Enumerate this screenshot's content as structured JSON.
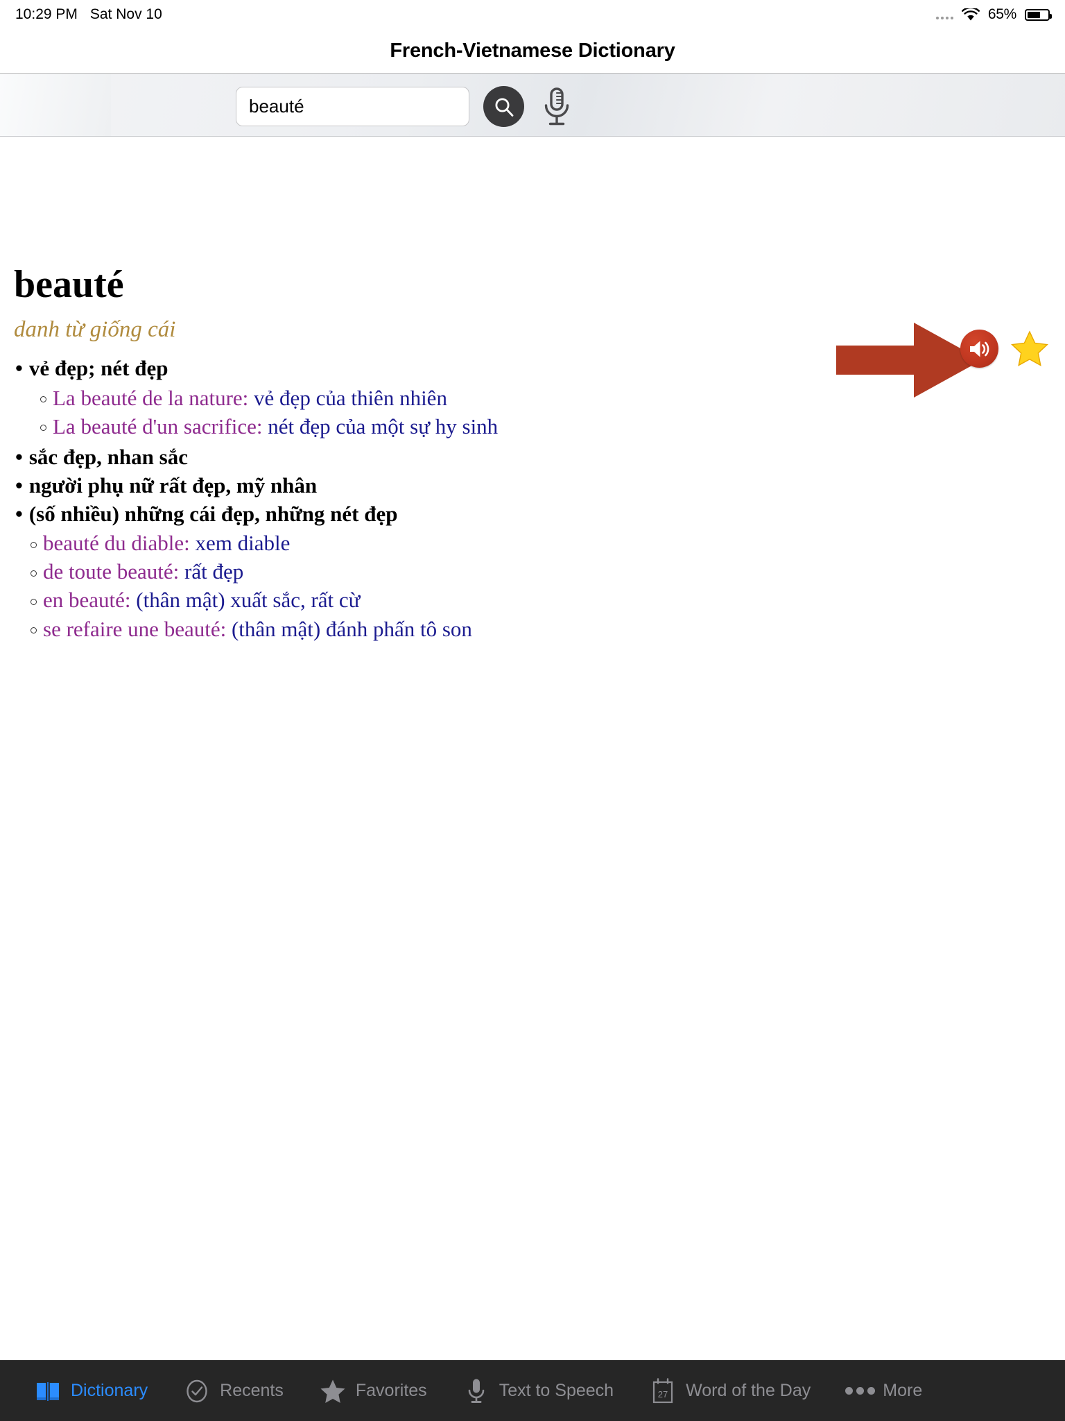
{
  "status_bar": {
    "time": "10:29 PM",
    "date": "Sat Nov 10",
    "battery_percent": "65%",
    "battery_level": 65,
    "wifi_icon": "wifi-icon",
    "cellular_icon": "signal-dots-icon",
    "battery_icon": "battery-icon"
  },
  "nav": {
    "title": "French-Vietnamese Dictionary"
  },
  "search": {
    "value": "beauté",
    "placeholder": "Search",
    "clear_icon": "clear-circle-icon",
    "search_icon": "search-icon",
    "mic_icon": "microphone-icon"
  },
  "entry_actions": {
    "speaker_icon": "speaker-icon",
    "favorite_icon": "star-icon",
    "annotation_icon": "red-arrow-annotation"
  },
  "entry": {
    "headword": "beauté",
    "part_of_speech": "danh từ giống cái",
    "senses": [
      {
        "bullet": "•",
        "text": "vẻ đẹp; nét đẹp",
        "examples": [
          {
            "fr": "La beauté de la nature: ",
            "vi": "vẻ đẹp của thiên nhiên"
          },
          {
            "fr": "La beauté d'un sacrifice: ",
            "vi": "nét đẹp của một sự hy sinh"
          }
        ]
      },
      {
        "bullet": "•",
        "text": "sắc đẹp, nhan sắc",
        "examples": []
      },
      {
        "bullet": "•",
        "text": "người phụ nữ rất đẹp, mỹ nhân",
        "examples": []
      },
      {
        "bullet": "•",
        "text": "(số nhiều) những cái đẹp, những nét đẹp",
        "examples": [
          {
            "fr": "beauté du diable: ",
            "vi": "xem diable"
          },
          {
            "fr": "de toute beauté: ",
            "vi": "rất đẹp"
          },
          {
            "fr": "en beauté: ",
            "vi": "(thân mật) xuất sắc, rất cừ"
          },
          {
            "fr": "se refaire une beauté: ",
            "vi": "(thân mật) đánh phấn tô son"
          }
        ]
      }
    ]
  },
  "tabbar": {
    "items": [
      {
        "label": "Dictionary",
        "icon": "book-icon",
        "active": true
      },
      {
        "label": "Recents",
        "icon": "clock-check-icon",
        "active": false
      },
      {
        "label": "Favorites",
        "icon": "star-icon",
        "active": false
      },
      {
        "label": "Text to Speech",
        "icon": "microphone-icon",
        "active": false
      },
      {
        "label": "Word of the Day",
        "icon": "calendar-icon",
        "active": false,
        "badge": "27"
      },
      {
        "label": "More",
        "icon": "ellipsis-icon",
        "active": false
      }
    ]
  },
  "colors": {
    "accent_blue": "#2b8cff",
    "example_french": "#8e2a8e",
    "example_vietnamese": "#1b1b8f",
    "pos_gold": "#b08b3e",
    "annotation_red": "#b03a22",
    "tabbar_bg": "#262626"
  }
}
